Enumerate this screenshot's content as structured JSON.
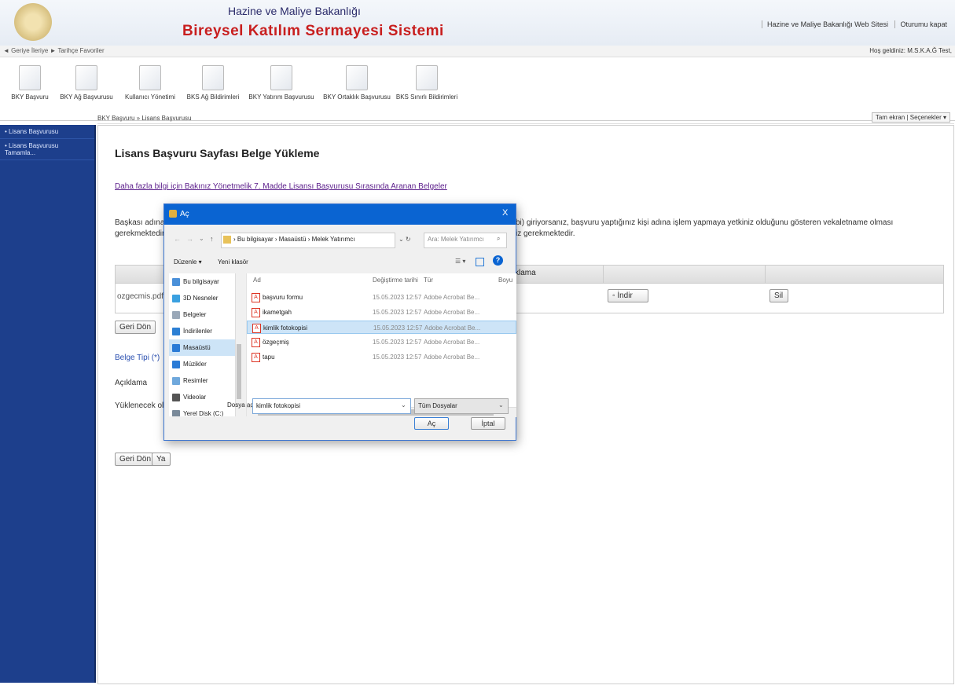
{
  "header": {
    "ministry": "Hazine ve Maliye Bakanlığı",
    "system": "Bireysel Katılım Sermayesi Sistemi",
    "links": [
      "Hazine ve Maliye Bakanlığı Web Sitesi",
      "Oturumu kapat"
    ]
  },
  "navbar": {
    "left": "◄ Geriye  İleriye ►  Tarihçe  Favoriler",
    "right": "Hoş geldiniz: M.S.K.A.Ğ Test,"
  },
  "toolbar": {
    "items": [
      {
        "label": "BKY Başvuru"
      },
      {
        "label": "BKY Ağ Başvurusu"
      },
      {
        "label": "Kullanıcı Yönetimi"
      },
      {
        "label": "BKS Ağ Bildirimleri"
      },
      {
        "label": "BKY Yatırım Başvurusu"
      },
      {
        "label": "BKY Ortaklık Başvurusu"
      },
      {
        "label": "BKS Sınırlı Bildirimleri"
      }
    ]
  },
  "sidebar": {
    "items": [
      "• Lisans Başvurusu",
      "• Lisans Başvurusu Tamamla..."
    ]
  },
  "breadcrumb": "BKY Başvuru  »  Lisans Başvurusu",
  "right_links": "Tam ekran | Seçenekler ▾",
  "page": {
    "title": "Lisans Başvuru Sayfası Belge Yükleme",
    "info_link": "Daha fazla bilgi için Bakınız Yönetmelik 7. Madde Lisansı Başvurusu Sırasında Aranan Belgeler",
    "note_left1": "Başkası adına b",
    "note_left2": "gerekmektedir.",
    "note_right1": "bi) giriyorsanız, başvuru yaptığınız kişi adına işlem yapmaya yetkiniz olduğunu gösteren vekaletname olması",
    "note_right2": "iz gerekmektedir.",
    "table_header": "klama",
    "file": "ozgecmis.pdf",
    "download_btn": "İndir",
    "delete_btn": "Sil",
    "back_btn": "Geri Dön",
    "doc_type_label": "Belge Tipi (*)",
    "desc_label": "Açıklama",
    "upload_label": "Yüklenecek ola",
    "back_btn2": "Geri Dön",
    "partial_btn": "Ya"
  },
  "dialog": {
    "title": "Aç",
    "address": "›  Bu bilgisayar  ›  Masaüstü  ›  Melek Yatırımcı",
    "search_placeholder": "Ara: Melek Yatırımcı",
    "organize": "Düzenle ▾",
    "new_folder": "Yeni klasör",
    "tree": [
      {
        "label": "Bu bilgisayar",
        "icon": "computer-icon",
        "color": "#4a90d9"
      },
      {
        "label": "3D Nesneler",
        "icon": "3d-objects-icon",
        "color": "#3aa0e0"
      },
      {
        "label": "Belgeler",
        "icon": "documents-icon",
        "color": "#9aa8b8"
      },
      {
        "label": "İndirilenler",
        "icon": "downloads-icon",
        "color": "#2c7fd4"
      },
      {
        "label": "Masaüstü",
        "icon": "desktop-icon",
        "color": "#2a7bd6",
        "selected": true
      },
      {
        "label": "Müzikler",
        "icon": "music-icon",
        "color": "#2a7bd6"
      },
      {
        "label": "Resimler",
        "icon": "pictures-icon",
        "color": "#6fa8dc"
      },
      {
        "label": "Videolar",
        "icon": "videos-icon",
        "color": "#555555"
      },
      {
        "label": "Yerel Disk (C:)",
        "icon": "disk-icon",
        "color": "#7a8a9a"
      }
    ],
    "columns": [
      "Ad",
      "Değiştirme tarihi",
      "Tür",
      "Boyu"
    ],
    "files": [
      {
        "name": "başvuru formu",
        "date": "15.05.2023 12:57",
        "type": "Adobe Acrobat Be..."
      },
      {
        "name": "ikametgah",
        "date": "15.05.2023 12:57",
        "type": "Adobe Acrobat Be..."
      },
      {
        "name": "kimlik fotokopisi",
        "date": "15.05.2023 12:57",
        "type": "Adobe Acrobat Be...",
        "selected": true
      },
      {
        "name": "özgeçmiş",
        "date": "15.05.2023 12:57",
        "type": "Adobe Acrobat Be..."
      },
      {
        "name": "tapu",
        "date": "15.05.2023 12:57",
        "type": "Adobe Acrobat Be..."
      }
    ],
    "filename_label": "Dosya adı:",
    "filename_value": "kimlik fotokopisi",
    "filetype": "Tüm Dosyalar",
    "open_btn": "Aç",
    "cancel_btn": "İptal"
  }
}
